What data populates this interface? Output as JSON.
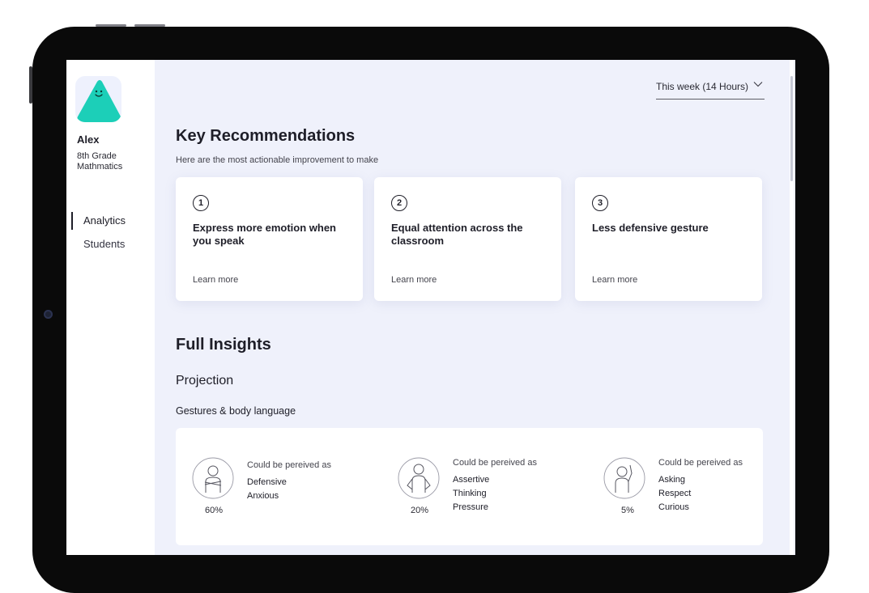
{
  "user": {
    "name": "Alex",
    "grade": "8th Grade Mathmatics"
  },
  "sidebar": {
    "items": [
      {
        "label": "Analytics",
        "active": true
      },
      {
        "label": "Students",
        "active": false
      }
    ]
  },
  "period_selector": {
    "value": "This week (14 Hours)",
    "icon": "chevron-down-icon"
  },
  "recommendations": {
    "title": "Key Recommendations",
    "subtitle": "Here are the most actionable improvement to make",
    "cards": [
      {
        "number": "1",
        "title": "Express more emotion when you speak",
        "link": "Learn more"
      },
      {
        "number": "2",
        "title": "Equal attention across the classroom",
        "link": "Learn more"
      },
      {
        "number": "3",
        "title": "Less defensive gesture",
        "link": "Learn more"
      }
    ]
  },
  "insights": {
    "title": "Full Insights",
    "section": "Projection",
    "subsection": "Gestures & body language",
    "items": [
      {
        "percent": "60%",
        "lead": "Could be pereived as",
        "traits": [
          "Defensive",
          "Anxious"
        ],
        "icon": "arms-crossed-figure-icon"
      },
      {
        "percent": "20%",
        "lead": "Could be pereived as",
        "traits": [
          "Assertive",
          "Thinking",
          "Pressure"
        ],
        "icon": "hands-on-hips-figure-icon"
      },
      {
        "percent": "5%",
        "lead": "Could be pereived as",
        "traits": [
          "Asking",
          "Respect",
          "Curious"
        ],
        "icon": "raised-hand-figure-icon"
      }
    ]
  },
  "colors": {
    "accent": "#1ccfb8",
    "background": "#eff1fb",
    "text": "#1e1e28"
  }
}
